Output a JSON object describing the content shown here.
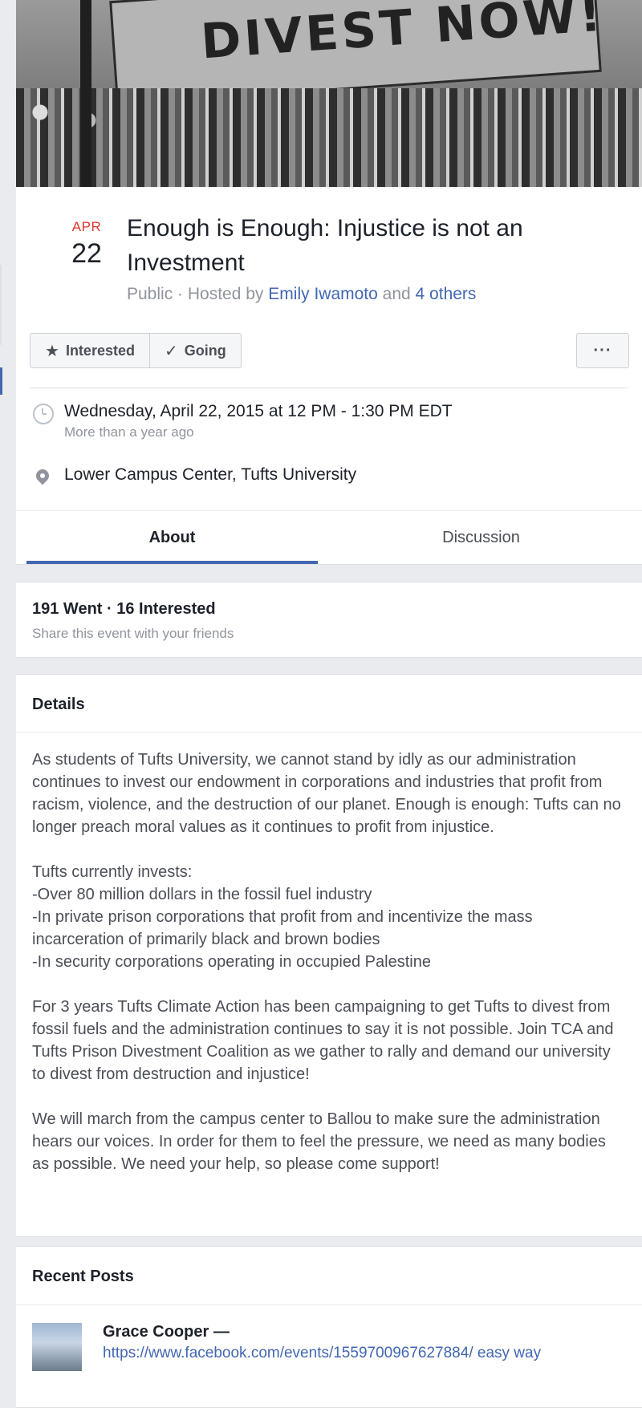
{
  "cover": {
    "banner_text": "DIVEST NOW!"
  },
  "event": {
    "month": "APR",
    "day": "22",
    "title": "Enough is Enough: Injustice is not an Investment",
    "privacy": "Public",
    "hosted_by_prefix": "Hosted by",
    "host_name": "Emily Iwamoto",
    "and_text": "and",
    "others_link": "4 others"
  },
  "actions": {
    "interested_label": "Interested",
    "going_label": "Going",
    "more_label": "···"
  },
  "info": {
    "datetime": "Wednesday, April 22, 2015 at 12 PM - 1:30 PM EDT",
    "relative_time": "More than a year ago",
    "location": "Lower Campus Center, Tufts University"
  },
  "tabs": {
    "about": "About",
    "discussion": "Discussion"
  },
  "stats": {
    "title": "191 Went · 16 Interested",
    "subtitle": "Share this event with your friends"
  },
  "details": {
    "title": "Details",
    "paragraphs": [
      "As students of Tufts University, we cannot stand by idly as our administration continues to invest our endowment in corporations and industries that profit from racism, violence, and the destruction of our planet. Enough is enough: Tufts can no longer preach moral values as it continues to profit from injustice.",
      "Tufts currently invests:\n-Over 80 million dollars in the fossil fuel industry\n-In private prison corporations that profit from and incentivize the mass incarceration of primarily black and brown bodies\n-In security corporations operating in occupied Palestine",
      "For 3 years Tufts Climate Action has been campaigning to get Tufts to divest from fossil fuels and the administration continues to say it is not possible. Join TCA and Tufts Prison Divestment Coalition as we gather to rally and demand our university to divest from destruction and injustice!",
      "We will march from the campus center to Ballou to make sure the administration hears our voices. In order for them to feel the pressure, we need as many bodies as possible. We need your help, so please come support!"
    ]
  },
  "recent_posts": {
    "title": "Recent Posts",
    "post_author": "Grace Cooper —",
    "post_link": "https://www.facebook.com/events/1559700967627884/ easy way"
  },
  "colors": {
    "accent": "#4267b2",
    "date_red": "#e3342f",
    "background": "#e9ebee"
  }
}
